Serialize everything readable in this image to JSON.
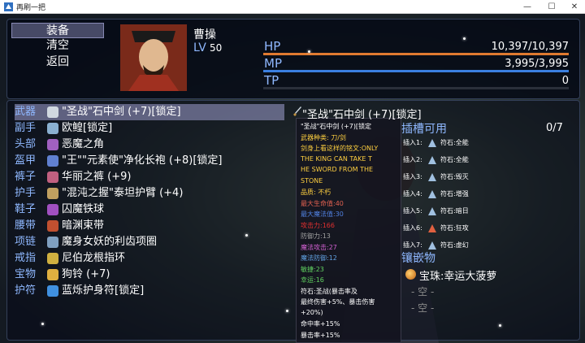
{
  "window": {
    "title": "再刷一把",
    "minimize": "—",
    "maximize": "☐",
    "close": "✕"
  },
  "commands": [
    "装备",
    "清空",
    "返回"
  ],
  "hero": {
    "name": "曹操",
    "lv_label": "LV",
    "lv_value": "50"
  },
  "stats": [
    {
      "label": "HP",
      "value": "10,397/10,397",
      "fill": 1.0,
      "color": "#e07a30"
    },
    {
      "label": "MP",
      "value": "3,995/3,995",
      "fill": 1.0,
      "color": "#3a7fe0"
    },
    {
      "label": "TP",
      "value": "0",
      "fill": 0.0,
      "color": "#40b050"
    }
  ],
  "slots": [
    {
      "slot": "武器",
      "item": "\"圣战\"石中剑 (+7)[锁定]",
      "icon_color": "#d0d8e0",
      "icon": "sword-icon"
    },
    {
      "slot": "副手",
      "item": "欧鳇[锁定]",
      "icon_color": "#8ab0d0",
      "icon": "shield-icon"
    },
    {
      "slot": "头部",
      "item": "恶魔之角",
      "icon_color": "#a060c0",
      "icon": "horn-icon"
    },
    {
      "slot": "盔甲",
      "item": "\"王\"\"元素使\"净化长袍 (+8)[锁定]",
      "icon_color": "#6080d0",
      "icon": "robe-icon"
    },
    {
      "slot": "裤子",
      "item": "华丽之裤 (+9)",
      "icon_color": "#c06080",
      "icon": "pants-icon"
    },
    {
      "slot": "护手",
      "item": "\"混沌之握\"泰坦护臂 (+4)",
      "icon_color": "#c0a060",
      "icon": "gauntlet-icon"
    },
    {
      "slot": "鞋子",
      "item": "囚魔铁球",
      "icon_color": "#a050c0",
      "icon": "iron-ball-icon"
    },
    {
      "slot": "腰带",
      "item": "暗渊束带",
      "icon_color": "#c05030",
      "icon": "belt-icon"
    },
    {
      "slot": "项链",
      "item": "魔身女妖的利齿项圈",
      "icon_color": "#80a0c0",
      "icon": "necklace-icon"
    },
    {
      "slot": "戒指",
      "item": "尼伯龙根指环",
      "icon_color": "#d0b040",
      "icon": "ring-icon"
    },
    {
      "slot": "宝物",
      "item": "狗铃 (+7)",
      "icon_color": "#e0b040",
      "icon": "bell-icon"
    },
    {
      "slot": "护符",
      "item": "蓝烁护身符[锁定]",
      "icon_color": "#4090e0",
      "icon": "amulet-icon"
    }
  ],
  "detail": {
    "title": "\"圣战\"石中剑 (+7)[锁定]",
    "socket_title": "插槽可用",
    "socket_count": "0/7",
    "sockets": [
      {
        "label": "插入1:",
        "text": "符石:全能",
        "color": "#a0c0e0"
      },
      {
        "label": "插入2:",
        "text": "符石:全能",
        "color": "#a0c0e0"
      },
      {
        "label": "插入3:",
        "text": "符石:毁灭",
        "color": "#a0c0e0"
      },
      {
        "label": "插入4:",
        "text": "符石:增强",
        "color": "#a0c0e0"
      },
      {
        "label": "插入5:",
        "text": "符石:暗日",
        "color": "#a0c0e0"
      },
      {
        "label": "插入6:",
        "text": "符石:狂攻",
        "color": "#e06040"
      },
      {
        "label": "插入7:",
        "text": "符石:虚幻",
        "color": "#a0c0e0"
      }
    ],
    "treasure_title": "镶嵌物",
    "treasure_item": "宝珠:幸运大菠萝",
    "empty_slots": [
      "- 空 -",
      "- 空 -"
    ]
  },
  "tooltip": [
    {
      "text": "\"圣战\"石中剑 (+7)[锁定",
      "color": "#ffffff"
    },
    {
      "text": "武器种类: 刀/剑",
      "color": "#ffd040"
    },
    {
      "text": "剑身上看这样的铭文:ONLY",
      "color": "#ffd040"
    },
    {
      "text": "THE KING CAN TAKE T",
      "color": "#ffd040"
    },
    {
      "text": "HE SWORD FROM THE",
      "color": "#ffd040"
    },
    {
      "text": "STONE",
      "color": "#ffd040"
    },
    {
      "text": "品质: 不朽",
      "color": "#ffd040"
    },
    {
      "text": "最大生命值:40",
      "color": "#e06050"
    },
    {
      "text": "最大魔法值:30",
      "color": "#5080e0"
    },
    {
      "text": "攻击力:166",
      "color": "#e03030"
    },
    {
      "text": "防御力:13",
      "color": "#a0a0a0"
    },
    {
      "text": "魔法攻击:27",
      "color": "#d060d0"
    },
    {
      "text": "魔法防御:12",
      "color": "#60a0e0"
    },
    {
      "text": "敏捷:23",
      "color": "#60d060"
    },
    {
      "text": "幸运:16",
      "color": "#60d060"
    },
    {
      "text": "符石:圣战(暴击率及",
      "color": "#ffffff"
    },
    {
      "text": "最终伤害+5%、暴击伤害",
      "color": "#ffffff"
    },
    {
      "text": "+20%)",
      "color": "#ffffff"
    },
    {
      "text": "命中率+15%",
      "color": "#ffffff"
    },
    {
      "text": "暴击率+15%",
      "color": "#ffffff"
    }
  ]
}
